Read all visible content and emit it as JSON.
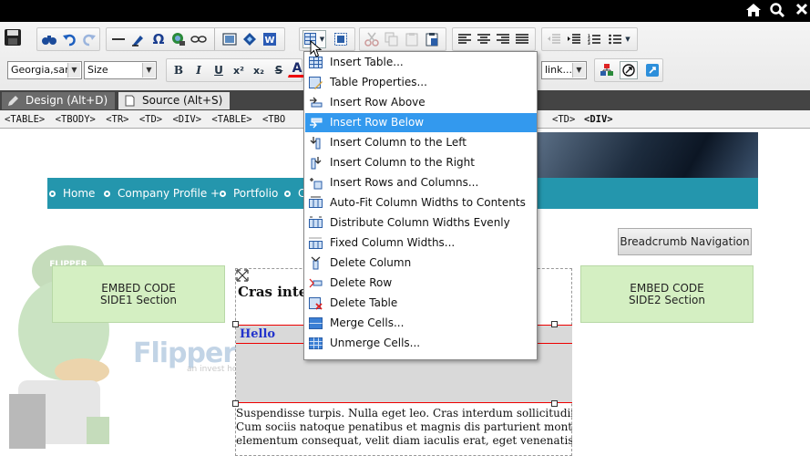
{
  "colors": {
    "topbar": "#000000",
    "menu_highlight": "#3399ee",
    "nav_bar": "#2496ad",
    "embed_bg": "#d4efc2",
    "hello_text": "#2233cc",
    "table_border": "#e00000"
  },
  "topbar": {
    "icons": [
      "home-icon",
      "search-icon",
      "close-icon"
    ]
  },
  "toolbar": {
    "font_family_value": "Georgia,san",
    "font_size_value": "Size",
    "link_select_value": "link...",
    "bold_label": "B",
    "italic_label": "I",
    "underline_label": "U",
    "superscript_label": "x²",
    "subscript_label": "x₂",
    "strike_label": "S",
    "forecolor_label": "A",
    "omega_label": "Ω"
  },
  "modes": {
    "design": "Design (Alt+D)",
    "source": "Source (Alt+S)"
  },
  "tagpath": [
    "<TABLE>",
    "<TBODY>",
    "<TR>",
    "<TD>",
    "<DIV>",
    "<TABLE>",
    "<TBO"
  ],
  "tagpath_right": [
    "<TD>",
    "<DIV>"
  ],
  "page": {
    "nav": [
      "Home",
      "Company Profile +",
      "Portfolio",
      "C"
    ],
    "breadcrumb_button": "Breadcrumb Navigation",
    "embed_left": [
      "EMBED CODE",
      "SIDE1 Section"
    ],
    "embed_right": [
      "EMBED CODE",
      "SIDE2 Section"
    ],
    "heading": "Cras inte",
    "hello": "Hello",
    "watermark": "FlipperHost",
    "watermark_sub": "an invest host company",
    "lorem": [
      "Suspendisse turpis. Nulla eget leo. Cras interdum sollicitudin an",
      "Cum sociis natoque penatibus et magnis dis parturient montes, n",
      "elementum consequat, velit diam iaculis erat, eget venenatis ne"
    ]
  },
  "menu": {
    "items": [
      {
        "label": "Insert Table...",
        "icon": "table-icon"
      },
      {
        "label": "Table Properties...",
        "icon": "table-properties-icon"
      },
      {
        "label": "Insert Row Above",
        "icon": "insert-row-above-icon"
      },
      {
        "label": "Insert Row Below",
        "icon": "insert-row-below-icon",
        "highlighted": true
      },
      {
        "label": "Insert Column to the Left",
        "icon": "insert-column-left-icon"
      },
      {
        "label": "Insert Column to the Right",
        "icon": "insert-column-right-icon"
      },
      {
        "label": "Insert Rows and Columns...",
        "icon": "insert-rows-columns-icon"
      },
      {
        "label": "Auto-Fit Column Widths to Contents",
        "icon": "autofit-columns-icon"
      },
      {
        "label": "Distribute Column Widths Evenly",
        "icon": "distribute-columns-icon"
      },
      {
        "label": "Fixed Column Widths...",
        "icon": "fixed-columns-icon"
      },
      {
        "label": "Delete Column",
        "icon": "delete-column-icon"
      },
      {
        "label": "Delete Row",
        "icon": "delete-row-icon"
      },
      {
        "label": "Delete Table",
        "icon": "delete-table-icon"
      },
      {
        "label": "Merge Cells...",
        "icon": "merge-cells-icon"
      },
      {
        "label": "Unmerge Cells...",
        "icon": "unmerge-cells-icon"
      }
    ]
  }
}
